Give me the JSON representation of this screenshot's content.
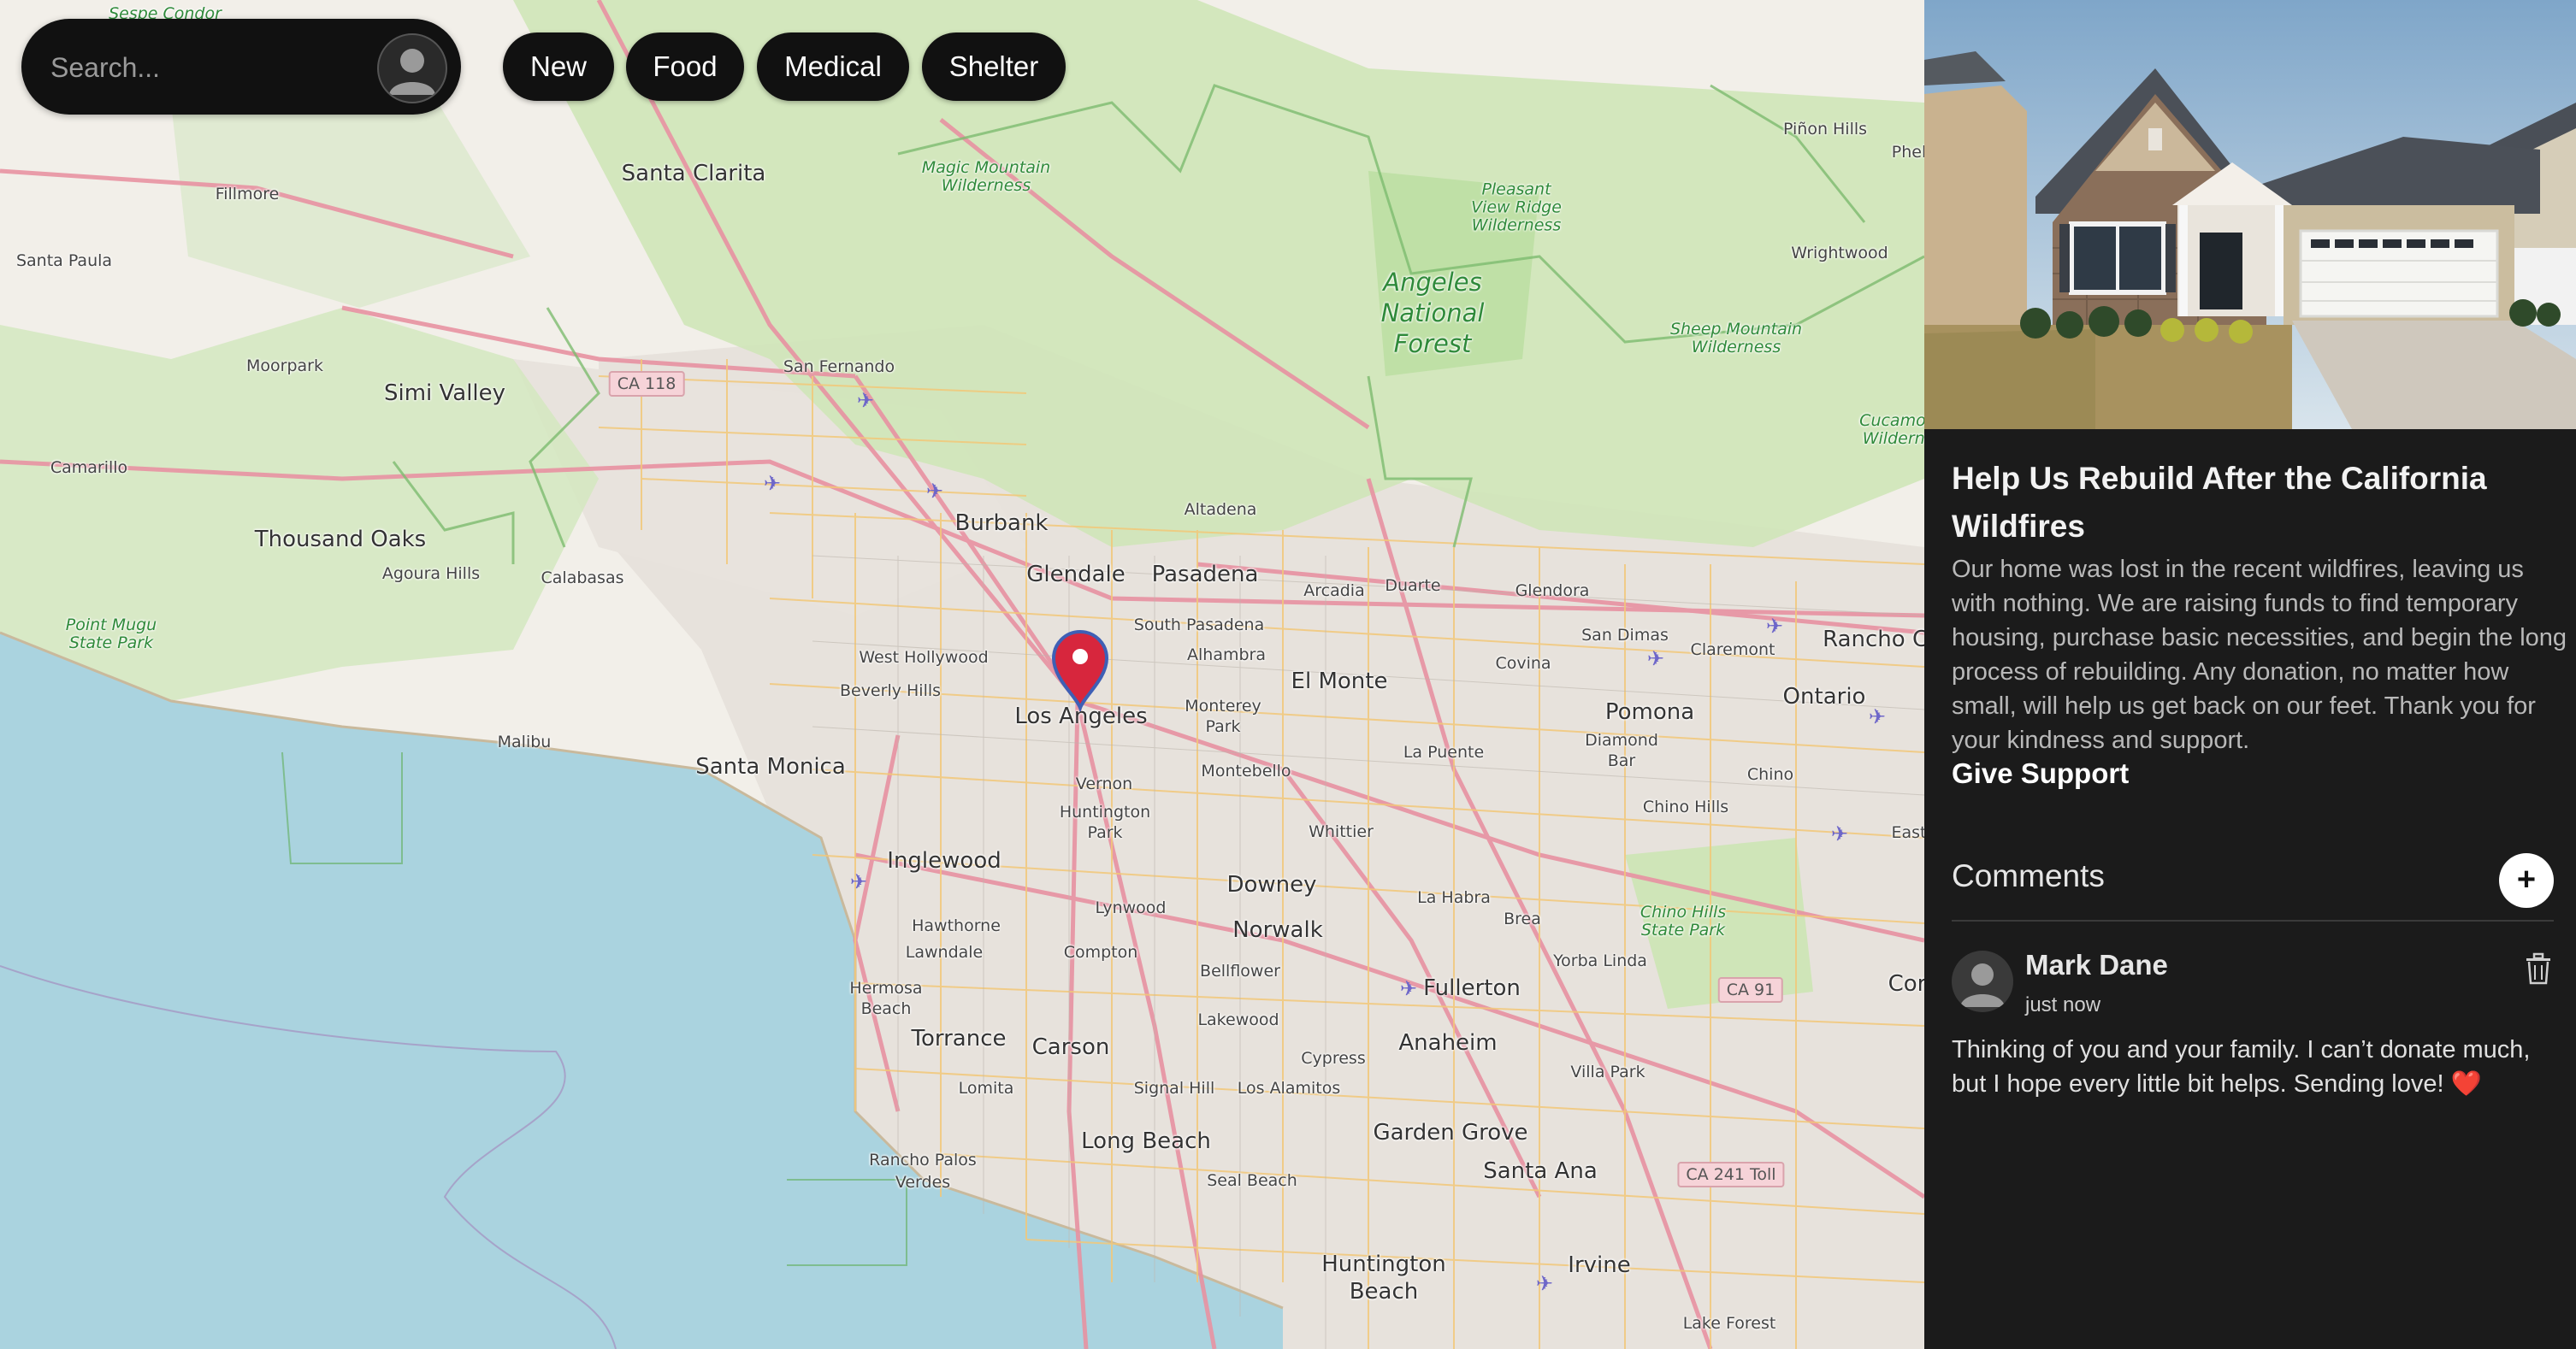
{
  "search": {
    "placeholder": "Search..."
  },
  "filters": [
    {
      "label": "New"
    },
    {
      "label": "Food"
    },
    {
      "label": "Medical"
    },
    {
      "label": "Shelter"
    }
  ],
  "map": {
    "places": [
      "Sespe Condor",
      "Santa Clarita",
      "Fillmore",
      "Santa Paula",
      "Magic Mountain Wilderness",
      "Pleasant View Ridge Wilderness",
      "Piñon Hills",
      "Phel",
      "Wrightwood",
      "Angeles National Forest",
      "Sheep Mountain Wilderness",
      "Cucamong Wildernes",
      "Moorpark",
      "Simi Valley",
      "San Fernando",
      "Camarillo",
      "Thousand Oaks",
      "Agoura Hills",
      "Calabasas",
      "Burbank",
      "Altadena",
      "Glendale",
      "Pasadena",
      "Arcadia",
      "Duarte",
      "Glendora",
      "Point Mugu State Park",
      "West Hollywood",
      "South Pasadena",
      "Alhambra",
      "San Dimas",
      "Claremont",
      "Rancho Cuc",
      "Beverly Hills",
      "Los Angeles",
      "Monterey Park",
      "El Monte",
      "Covina",
      "Pomona",
      "Ontario",
      "Malibu",
      "Santa Monica",
      "Montebello",
      "La Puente",
      "Diamond Bar",
      "Vernon",
      "Huntington Park",
      "Whittier",
      "Chino",
      "Chino Hills",
      "East",
      "Inglewood",
      "Lynwood",
      "Downey",
      "La Habra",
      "Brea",
      "Chino Hills State Park",
      "Hawthorne",
      "Lawndale",
      "Compton",
      "Norwalk",
      "Yorba Linda",
      "Bellflower",
      "Fullerton",
      "Cor",
      "Hermosa Beach",
      "Torrance",
      "Carson",
      "Lakewood",
      "Anaheim",
      "Cypress",
      "Villa Park",
      "Lomita",
      "Signal Hill",
      "Los Alamitos",
      "Rancho Palos Verdes",
      "Long Beach",
      "Garden Grove",
      "Seal Beach",
      "Santa Ana",
      "Huntington Beach",
      "Irvine",
      "Lake Forest"
    ],
    "shields": [
      "CA 118",
      "CA 91",
      "CA 241 Toll"
    ],
    "marker": {
      "name": "Los Angeles",
      "color": "#d7263d"
    }
  },
  "post": {
    "title": "Help Us Rebuild After the California Wildfires",
    "body": "Our home was lost in the recent wildfires, leaving us with nothing. We are raising funds to find temporary housing, purchase basic necessities, and begin the long process of rebuilding. Any donation, no matter how small, will help us get back on our feet. Thank you for your kindness and support.",
    "cta": "Give Support"
  },
  "comments": {
    "title": "Comments",
    "add_label": "+",
    "items": [
      {
        "author": "Mark Dane",
        "time": "just now",
        "text": "Thinking of you and your family. I can’t donate much, but I hope every little bit helps. Sending love! ❤️"
      }
    ]
  },
  "colors": {
    "panel_bg": "#1b1b1b",
    "chip_bg": "#111111",
    "water": "#aad3df",
    "park": "#c8e6b4",
    "marker": "#d7263d"
  }
}
